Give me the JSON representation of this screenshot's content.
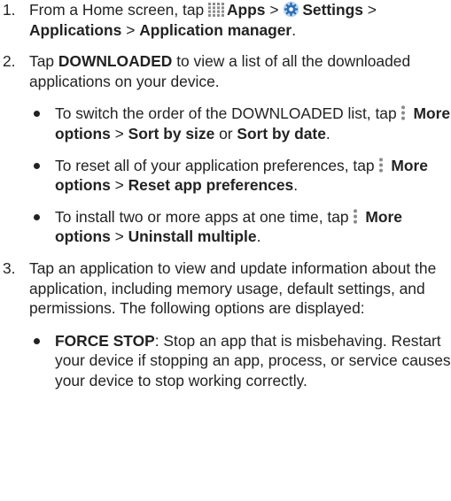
{
  "steps": [
    {
      "number": "1.",
      "parts": [
        "From a Home screen, tap ",
        "Apps",
        " > ",
        "Settings",
        " > ",
        "Applications",
        " > ",
        "Application manager",
        "."
      ],
      "icons": [
        "apps-grid-icon",
        "settings-gear-icon"
      ]
    },
    {
      "number": "2.",
      "parts": [
        "Tap ",
        "DOWNLOADED",
        " to view a list of all the downloaded applications on your device."
      ],
      "bullets": [
        {
          "parts": [
            "To switch the order of the DOWNLOADED list, tap ",
            "More options",
            " > ",
            "Sort by size",
            " or ",
            "Sort by date",
            "."
          ],
          "icons": [
            "more-options-icon"
          ]
        },
        {
          "parts": [
            "To reset all of your application preferences, tap ",
            "More options",
            " > ",
            "Reset app preferences",
            "."
          ],
          "icons": [
            "more-options-icon"
          ]
        },
        {
          "parts": [
            "To install two or more apps at one time, tap ",
            "More options",
            " > ",
            "Uninstall multiple",
            "."
          ],
          "icons": [
            "more-options-icon"
          ]
        }
      ]
    },
    {
      "number": "3.",
      "parts": [
        "Tap an application to view and update information about the application, including memory usage, default settings, and permissions. The following options are displayed:"
      ],
      "bullets": [
        {
          "parts": [
            "FORCE STOP",
            ": Stop an app that is misbehaving. Restart your device if stopping an app, process, or service causes your device to stop working correctly."
          ]
        }
      ]
    }
  ],
  "colors": {
    "text": "#222222",
    "icon_grey": "#8a8a8a",
    "gear_blue": "#2f6fb5",
    "gear_light": "#bcd6ef"
  }
}
